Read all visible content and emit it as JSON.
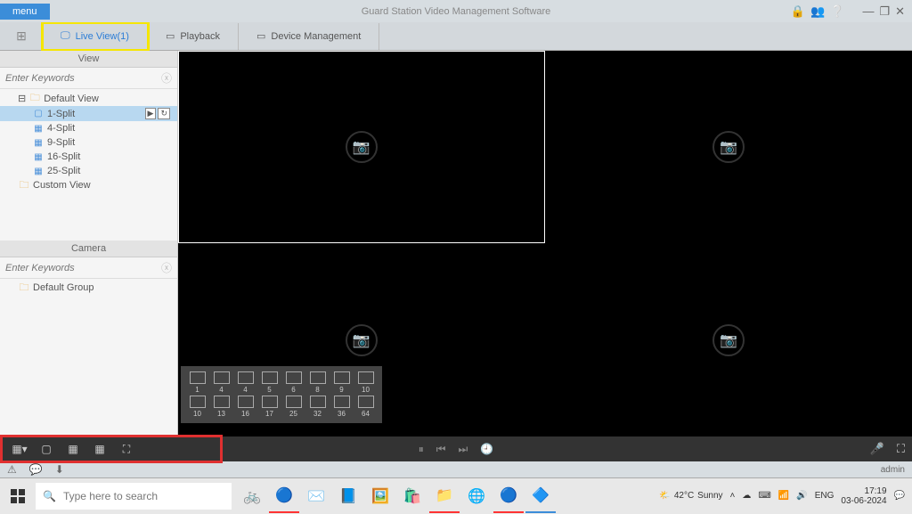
{
  "title": "Guard Station Video Management Software",
  "menu_label": "menu",
  "tabs": {
    "live": "Live View(1)",
    "playback": "Playback",
    "device": "Device Management"
  },
  "sidebar": {
    "view_head": "View",
    "camera_head": "Camera",
    "search_ph": "Enter Keywords",
    "default_view": "Default View",
    "splits": [
      "1-Split",
      "4-Split",
      "9-Split",
      "16-Split",
      "25-Split"
    ],
    "custom_view": "Custom View",
    "default_group": "Default Group"
  },
  "layout_popup": {
    "row1": [
      "1",
      "4",
      "4",
      "5",
      "6",
      "8",
      "9",
      "10"
    ],
    "row2": [
      "10",
      "13",
      "16",
      "17",
      "25",
      "32",
      "36",
      "64"
    ]
  },
  "status_user": "admin",
  "taskbar": {
    "search_ph": "Type here to search",
    "weather_temp": "42°C",
    "weather_cond": "Sunny",
    "lang": "ENG",
    "time": "17:19",
    "date": "03-06-2024"
  }
}
